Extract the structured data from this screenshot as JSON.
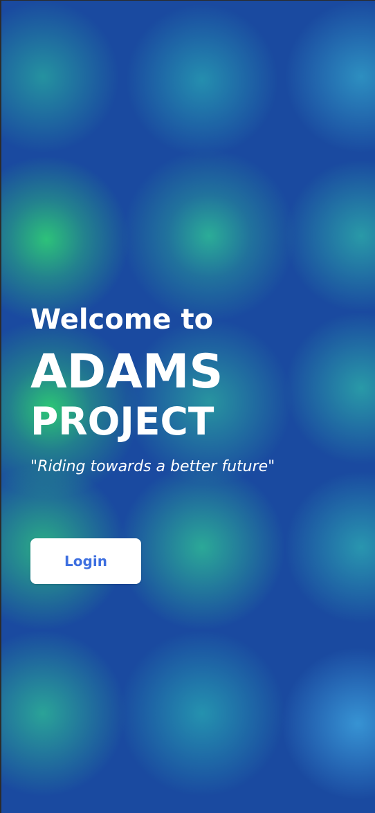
{
  "welcome": {
    "heading": "Welcome to",
    "brand_line1": "ADAMS",
    "brand_line2": "PROJECT",
    "tagline": "\"Riding towards a better future\""
  },
  "actions": {
    "login_label": "Login"
  },
  "colors": {
    "background_base": "#1a4aa0",
    "glow_green": "#2ec878",
    "text": "#ffffff",
    "button_bg": "#ffffff",
    "button_text": "#3d6fe0"
  }
}
